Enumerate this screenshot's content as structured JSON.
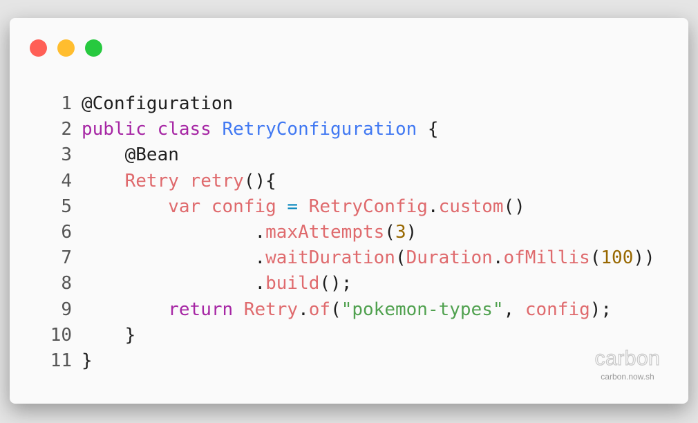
{
  "window_controls": {
    "close_color": "#ff5f56",
    "minimize_color": "#ffbd2e",
    "maximize_color": "#27c93f"
  },
  "code_lines": [
    {
      "n": "1",
      "tokens": [
        {
          "t": "@Configuration",
          "c": "plain"
        }
      ]
    },
    {
      "n": "2",
      "tokens": [
        {
          "t": "public class ",
          "c": "kw"
        },
        {
          "t": "RetryConfiguration",
          "c": "cls"
        },
        {
          "t": " {",
          "c": "plain"
        }
      ]
    },
    {
      "n": "3",
      "tokens": [
        {
          "t": "    @Bean",
          "c": "plain"
        }
      ]
    },
    {
      "n": "4",
      "tokens": [
        {
          "t": "    ",
          "c": "plain"
        },
        {
          "t": "Retry retry",
          "c": "fn"
        },
        {
          "t": "(){",
          "c": "plain"
        }
      ]
    },
    {
      "n": "5",
      "tokens": [
        {
          "t": "        ",
          "c": "plain"
        },
        {
          "t": "var config ",
          "c": "fn"
        },
        {
          "t": "=",
          "c": "op"
        },
        {
          "t": " ",
          "c": "plain"
        },
        {
          "t": "RetryConfig",
          "c": "fn"
        },
        {
          "t": ".",
          "c": "plain"
        },
        {
          "t": "custom",
          "c": "fn"
        },
        {
          "t": "()",
          "c": "plain"
        }
      ]
    },
    {
      "n": "6",
      "tokens": [
        {
          "t": "                .",
          "c": "plain"
        },
        {
          "t": "maxAttempts",
          "c": "fn"
        },
        {
          "t": "(",
          "c": "plain"
        },
        {
          "t": "3",
          "c": "num"
        },
        {
          "t": ")",
          "c": "plain"
        }
      ]
    },
    {
      "n": "7",
      "tokens": [
        {
          "t": "                .",
          "c": "plain"
        },
        {
          "t": "waitDuration",
          "c": "fn"
        },
        {
          "t": "(",
          "c": "plain"
        },
        {
          "t": "Duration",
          "c": "fn"
        },
        {
          "t": ".",
          "c": "plain"
        },
        {
          "t": "ofMillis",
          "c": "fn"
        },
        {
          "t": "(",
          "c": "plain"
        },
        {
          "t": "100",
          "c": "num"
        },
        {
          "t": "))",
          "c": "plain"
        }
      ]
    },
    {
      "n": "8",
      "tokens": [
        {
          "t": "                .",
          "c": "plain"
        },
        {
          "t": "build",
          "c": "fn"
        },
        {
          "t": "();",
          "c": "plain"
        }
      ]
    },
    {
      "n": "9",
      "tokens": [
        {
          "t": "        ",
          "c": "plain"
        },
        {
          "t": "return ",
          "c": "kw"
        },
        {
          "t": "Retry",
          "c": "fn"
        },
        {
          "t": ".",
          "c": "plain"
        },
        {
          "t": "of",
          "c": "fn"
        },
        {
          "t": "(",
          "c": "plain"
        },
        {
          "t": "\"pokemon-types\"",
          "c": "str"
        },
        {
          "t": ", ",
          "c": "plain"
        },
        {
          "t": "config",
          "c": "fn"
        },
        {
          "t": ");",
          "c": "plain"
        }
      ]
    },
    {
      "n": "10",
      "tokens": [
        {
          "t": "    }",
          "c": "plain"
        }
      ]
    },
    {
      "n": "11",
      "tokens": [
        {
          "t": "}",
          "c": "plain"
        }
      ]
    }
  ],
  "watermark": {
    "logo": "carbon",
    "url": "carbon.now.sh"
  }
}
